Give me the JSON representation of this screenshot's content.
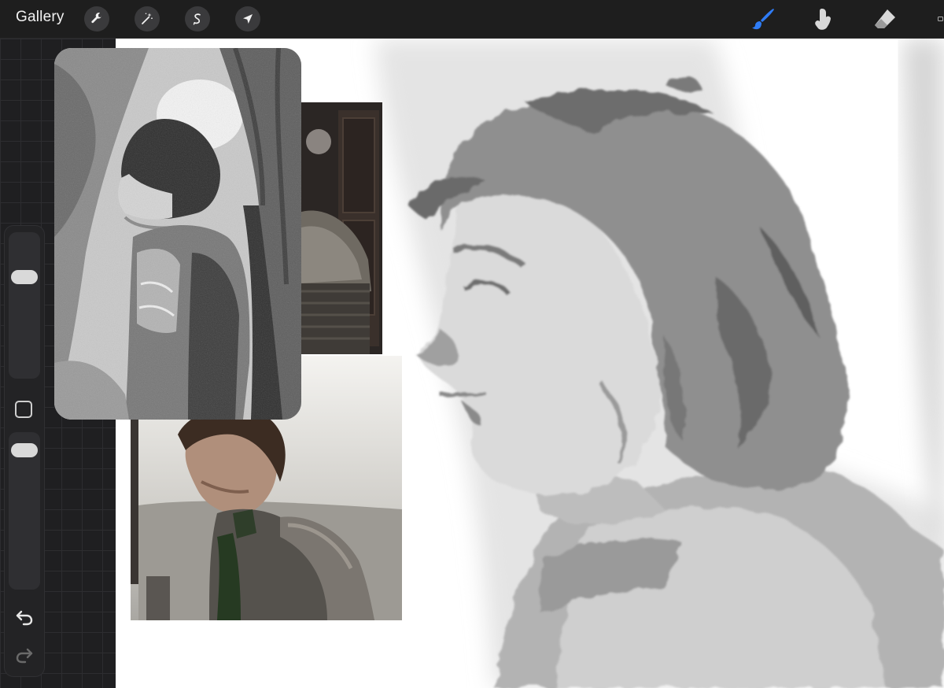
{
  "toolbar": {
    "gallery_label": "Gallery",
    "left_tools": [
      "wrench-icon",
      "magic-wand-icon",
      "selection-icon",
      "transform-arrow-icon"
    ],
    "right_tools": [
      "brush-icon",
      "smudge-icon",
      "eraser-icon",
      "layers-icon"
    ],
    "active_tool": "brush-icon",
    "accent_color": "#2f7cf6"
  },
  "sidebar": {
    "size_slider_level": 0.2,
    "opacity_slider_level": 0.05,
    "icons": [
      "modify-square-icon",
      "undo-icon",
      "redo-icon"
    ]
  },
  "colors": {
    "chrome": "#1e1e1e",
    "canvas": "#ffffff",
    "sketch_gray": "#8f8f8f"
  }
}
